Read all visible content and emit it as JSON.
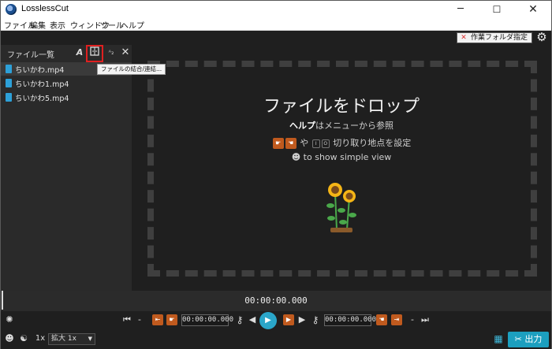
{
  "window": {
    "title": "LosslessCut",
    "min_glyph": "─",
    "max_glyph": "☐",
    "close_glyph": "✕"
  },
  "menu": [
    "ファイル",
    "編集",
    "表示",
    "ウィンドウ",
    "ツール",
    "ヘルプ"
  ],
  "topbar": {
    "workdir_label": "作業フォルダ指定",
    "workdir_clear": "✕"
  },
  "filelist": {
    "title": "ファイル一覧",
    "tooltip": "ファイルの結合/連結...",
    "files": [
      "ちいかわ.mp4",
      "ちいかわ1.mp4",
      "ちいかわ5.mp4"
    ],
    "selected_index": 0
  },
  "drop": {
    "title": "ファイルをドロップ",
    "help_bold": "ヘルプ",
    "help_rest": "はメニューから参照",
    "cut_or": "や",
    "key_i": "I",
    "key_o": "O",
    "cut_rest": "切り取り地点を設定",
    "simple": "to show simple view"
  },
  "timeline": {
    "timecode": "00:00:00.000"
  },
  "controls": {
    "cut_start": "00:00:00.000",
    "cut_end": "00:00:00.000",
    "dash": "-"
  },
  "bottom": {
    "speed": "1x",
    "zoom": "拡大 1x",
    "export": "出力"
  },
  "colors": {
    "accent": "#2aa6c9",
    "cut_button": "#c05a1e",
    "highlight": "#e02020"
  }
}
